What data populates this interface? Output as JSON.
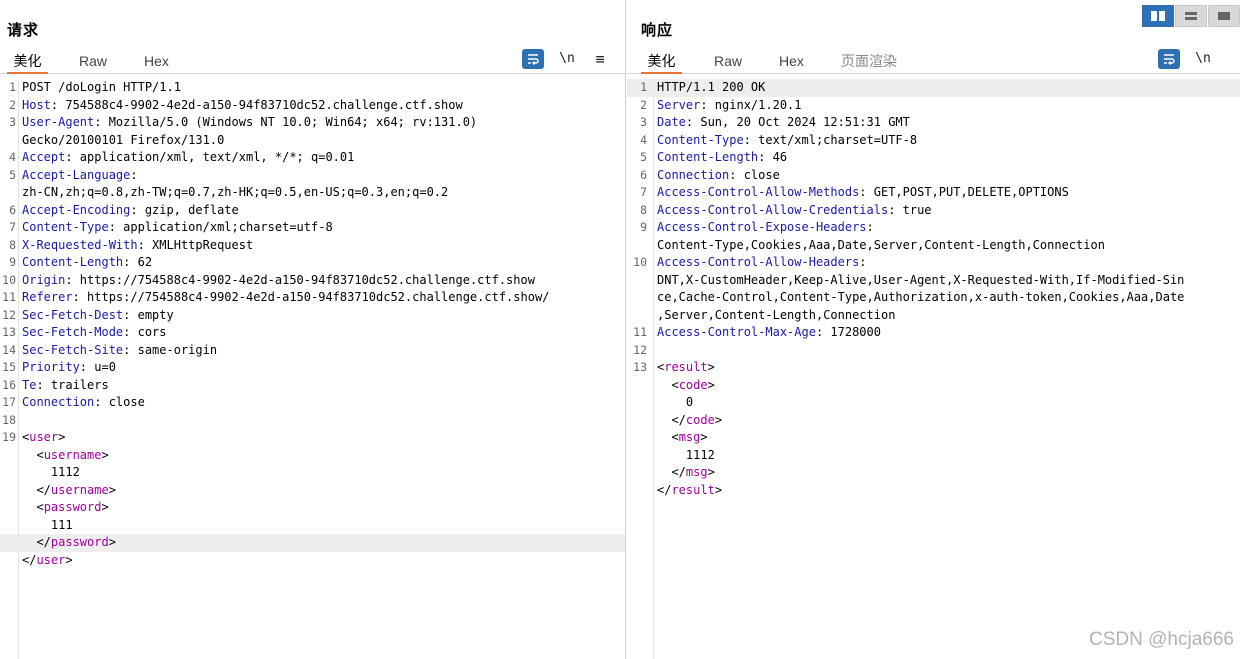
{
  "request": {
    "title": "请求",
    "tabs": [
      "美化",
      "Raw",
      "Hex"
    ],
    "newline_label": "\\n",
    "menu_label": "≡",
    "lines": [
      {
        "n": "1",
        "segs": [
          [
            "POST /doLogin HTTP/1.1",
            ""
          ]
        ]
      },
      {
        "n": "2",
        "segs": [
          [
            "Host",
            "k"
          ],
          [
            ": 754588c4-9902-4e2d-a150-94f83710dc52.challenge.ctf.show",
            ""
          ]
        ]
      },
      {
        "n": "3",
        "segs": [
          [
            "User-Agent",
            "k"
          ],
          [
            ": Mozilla/5.0 (Windows NT 10.0; Win64; x64; rv:131.0)",
            ""
          ]
        ]
      },
      {
        "n": "",
        "segs": [
          [
            "Gecko/20100101 Firefox/131.0",
            ""
          ]
        ]
      },
      {
        "n": "4",
        "segs": [
          [
            "Accept",
            "k"
          ],
          [
            ": application/xml, text/xml, */*; q=0.01",
            ""
          ]
        ]
      },
      {
        "n": "5",
        "segs": [
          [
            "Accept-Language",
            "k"
          ],
          [
            ":",
            ""
          ]
        ]
      },
      {
        "n": "",
        "segs": [
          [
            "zh-CN,zh;q=0.8,zh-TW;q=0.7,zh-HK;q=0.5,en-US;q=0.3,en;q=0.2",
            ""
          ]
        ]
      },
      {
        "n": "6",
        "segs": [
          [
            "Accept-Encoding",
            "k"
          ],
          [
            ": gzip, deflate",
            ""
          ]
        ]
      },
      {
        "n": "7",
        "segs": [
          [
            "Content-Type",
            "k"
          ],
          [
            ": application/xml;charset=utf-8",
            ""
          ]
        ]
      },
      {
        "n": "8",
        "segs": [
          [
            "X-Requested-With",
            "k"
          ],
          [
            ": XMLHttpRequest",
            ""
          ]
        ]
      },
      {
        "n": "9",
        "segs": [
          [
            "Content-Length",
            "k"
          ],
          [
            ": 62",
            ""
          ]
        ]
      },
      {
        "n": "10",
        "segs": [
          [
            "Origin",
            "k"
          ],
          [
            ": https://754588c4-9902-4e2d-a150-94f83710dc52.challenge.ctf.show",
            ""
          ]
        ]
      },
      {
        "n": "11",
        "segs": [
          [
            "Referer",
            "k"
          ],
          [
            ": https://754588c4-9902-4e2d-a150-94f83710dc52.challenge.ctf.show/",
            ""
          ]
        ]
      },
      {
        "n": "12",
        "segs": [
          [
            "Sec-Fetch-Dest",
            "k"
          ],
          [
            ": empty",
            ""
          ]
        ]
      },
      {
        "n": "13",
        "segs": [
          [
            "Sec-Fetch-Mode",
            "k"
          ],
          [
            ": cors",
            ""
          ]
        ]
      },
      {
        "n": "14",
        "segs": [
          [
            "Sec-Fetch-Site",
            "k"
          ],
          [
            ": same-origin",
            ""
          ]
        ]
      },
      {
        "n": "15",
        "segs": [
          [
            "Priority",
            "k"
          ],
          [
            ": u=0",
            ""
          ]
        ]
      },
      {
        "n": "16",
        "segs": [
          [
            "Te",
            "k"
          ],
          [
            ": trailers",
            ""
          ]
        ]
      },
      {
        "n": "17",
        "segs": [
          [
            "Connection",
            "k"
          ],
          [
            ": close",
            ""
          ]
        ]
      },
      {
        "n": "18",
        "segs": []
      },
      {
        "n": "19",
        "segs": [
          [
            "<",
            ""
          ],
          [
            "user",
            "t"
          ],
          [
            ">",
            ""
          ]
        ]
      },
      {
        "n": "",
        "segs": [
          [
            "  <",
            ""
          ],
          [
            "username",
            "t"
          ],
          [
            ">",
            ""
          ]
        ]
      },
      {
        "n": "",
        "segs": [
          [
            "    1112",
            ""
          ]
        ]
      },
      {
        "n": "",
        "segs": [
          [
            "  </",
            ""
          ],
          [
            "username",
            "t"
          ],
          [
            ">",
            ""
          ]
        ]
      },
      {
        "n": "",
        "segs": [
          [
            "  <",
            ""
          ],
          [
            "password",
            "t"
          ],
          [
            ">",
            ""
          ]
        ]
      },
      {
        "n": "",
        "segs": [
          [
            "    111",
            ""
          ]
        ]
      },
      {
        "n": "",
        "hl": true,
        "segs": [
          [
            "  </",
            ""
          ],
          [
            "password",
            "t"
          ],
          [
            ">",
            ""
          ]
        ]
      },
      {
        "n": "",
        "segs": [
          [
            "</",
            ""
          ],
          [
            "user",
            "t"
          ],
          [
            ">",
            ""
          ]
        ]
      }
    ]
  },
  "response": {
    "title": "响应",
    "tabs": [
      "美化",
      "Raw",
      "Hex",
      "页面渲染"
    ],
    "newline_label": "\\n",
    "lines": [
      {
        "n": "1",
        "hl": true,
        "segs": [
          [
            "HTTP/1.1 200 OK",
            ""
          ]
        ]
      },
      {
        "n": "2",
        "segs": [
          [
            "Server",
            "k"
          ],
          [
            ": nginx/1.20.1",
            ""
          ]
        ]
      },
      {
        "n": "3",
        "segs": [
          [
            "Date",
            "k"
          ],
          [
            ": Sun, 20 Oct 2024 12:51:31 GMT",
            ""
          ]
        ]
      },
      {
        "n": "4",
        "segs": [
          [
            "Content-Type",
            "k"
          ],
          [
            ": text/xml;charset=UTF-8",
            ""
          ]
        ]
      },
      {
        "n": "5",
        "segs": [
          [
            "Content-Length",
            "k"
          ],
          [
            ": 46",
            ""
          ]
        ]
      },
      {
        "n": "6",
        "segs": [
          [
            "Connection",
            "k"
          ],
          [
            ": close",
            ""
          ]
        ]
      },
      {
        "n": "7",
        "segs": [
          [
            "Access-Control-Allow-Methods",
            "k"
          ],
          [
            ": GET,POST,PUT,DELETE,OPTIONS",
            ""
          ]
        ]
      },
      {
        "n": "8",
        "segs": [
          [
            "Access-Control-Allow-Credentials",
            "k"
          ],
          [
            ": true",
            ""
          ]
        ]
      },
      {
        "n": "9",
        "segs": [
          [
            "Access-Control-Expose-Headers",
            "k"
          ],
          [
            ":",
            ""
          ]
        ]
      },
      {
        "n": "",
        "segs": [
          [
            "Content-Type,Cookies,Aaa,Date,Server,Content-Length,Connection",
            ""
          ]
        ]
      },
      {
        "n": "10",
        "segs": [
          [
            "Access-Control-Allow-Headers",
            "k"
          ],
          [
            ":",
            ""
          ]
        ]
      },
      {
        "n": "",
        "segs": [
          [
            "DNT,X-CustomHeader,Keep-Alive,User-Agent,X-Requested-With,If-Modified-Sin",
            ""
          ]
        ]
      },
      {
        "n": "",
        "segs": [
          [
            "ce,Cache-Control,Content-Type,Authorization,x-auth-token,Cookies,Aaa,Date",
            ""
          ]
        ]
      },
      {
        "n": "",
        "segs": [
          [
            ",Server,Content-Length,Connection",
            ""
          ]
        ]
      },
      {
        "n": "11",
        "segs": [
          [
            "Access-Control-Max-Age",
            "k"
          ],
          [
            ": 1728000",
            ""
          ]
        ]
      },
      {
        "n": "12",
        "segs": []
      },
      {
        "n": "13",
        "segs": [
          [
            "<",
            ""
          ],
          [
            "result",
            "t"
          ],
          [
            ">",
            ""
          ]
        ]
      },
      {
        "n": "",
        "segs": [
          [
            "  <",
            ""
          ],
          [
            "code",
            "t"
          ],
          [
            ">",
            ""
          ]
        ]
      },
      {
        "n": "",
        "segs": [
          [
            "    0",
            ""
          ]
        ]
      },
      {
        "n": "",
        "segs": [
          [
            "  </",
            ""
          ],
          [
            "code",
            "t"
          ],
          [
            ">",
            ""
          ]
        ]
      },
      {
        "n": "",
        "segs": [
          [
            "  <",
            ""
          ],
          [
            "msg",
            "t"
          ],
          [
            ">",
            ""
          ]
        ]
      },
      {
        "n": "",
        "segs": [
          [
            "    1112",
            ""
          ]
        ]
      },
      {
        "n": "",
        "segs": [
          [
            "  </",
            ""
          ],
          [
            "msg",
            "t"
          ],
          [
            ">",
            ""
          ]
        ]
      },
      {
        "n": "",
        "segs": [
          [
            "</",
            ""
          ],
          [
            "result",
            "t"
          ],
          [
            ">",
            ""
          ]
        ]
      }
    ]
  },
  "watermark": "CSDN @hcja666",
  "colors": {
    "accent": "#2f6fb4",
    "tab_underline": "#e8743b",
    "header_key": "#1a1aa6",
    "xml_tag": "#a000a0"
  }
}
